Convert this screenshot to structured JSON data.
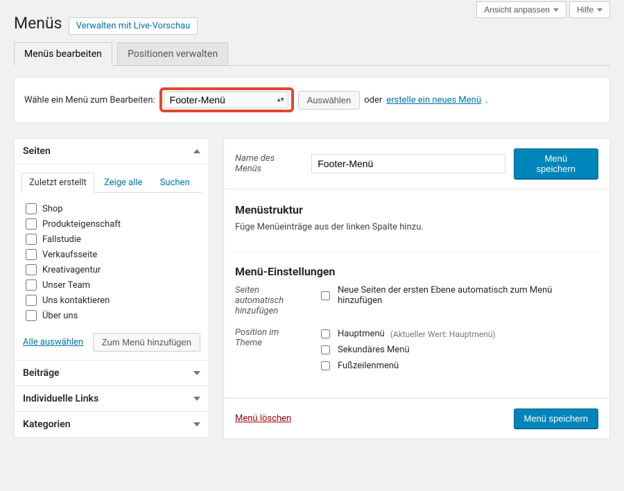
{
  "screen_options": {
    "customize": "Ansicht anpassen",
    "help": "Hilfe"
  },
  "page": {
    "title": "Menüs",
    "live_preview": "Verwalten mit Live-Vorschau"
  },
  "tabs": {
    "edit": "Menüs bearbeiten",
    "locations": "Positionen verwalten"
  },
  "selector": {
    "label": "Wähle ein Menü zum Bearbeiten:",
    "value": "Footer-Menü",
    "select_btn": "Auswählen",
    "or": "oder",
    "create_link": "erstelle ein neues Menü",
    "period": "."
  },
  "side": {
    "pages_title": "Seiten",
    "posts_title": "Beiträge",
    "links_title": "Individuelle Links",
    "cats_title": "Kategorien",
    "inner_tabs": {
      "recent": "Zuletzt erstellt",
      "all": "Zeige alle",
      "search": "Suchen"
    },
    "items": [
      "Shop",
      "Produkteigenschaft",
      "Fallstudie",
      "Verkaufsseite",
      "Kreativagentur",
      "Unser Team",
      "Uns kontaktieren",
      "Über uns"
    ],
    "select_all": "Alle auswählen",
    "add_btn": "Zum Menü hinzufügen"
  },
  "menu": {
    "name_label": "Name des Menüs",
    "name_value": "Footer-Menü",
    "save_btn": "Menü speichern",
    "structure_heading": "Menüstruktur",
    "structure_desc": "Füge Menüeinträge aus der linken Spalte hinzu.",
    "settings_heading": "Menü-Einstellungen",
    "auto_add_label": "Seiten automatisch hinzufügen",
    "auto_add_opt": "Neue Seiten der ersten Ebene automatisch zum Menü hinzufügen",
    "position_label": "Position im Theme",
    "pos_main": "Hauptmenü",
    "pos_main_hint": "(Aktueller Wert: Hauptmenü)",
    "pos_secondary": "Sekundäres Menü",
    "pos_footer": "Fußzeilenmenü",
    "delete": "Menü löschen"
  }
}
